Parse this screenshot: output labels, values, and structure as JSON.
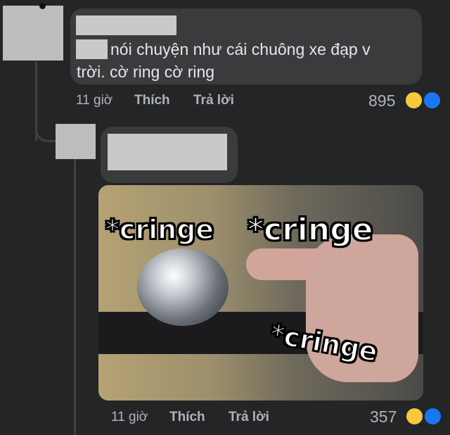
{
  "comment1": {
    "text_line1": "nói chuyện như cái chuông xe đạp v",
    "text_line2": "trời. cờ ring cờ ring",
    "time": "11 giờ",
    "like_label": "Thích",
    "reply_label": "Trả lời",
    "reaction_count": "895",
    "reactions": [
      "haha-icon",
      "like-icon"
    ]
  },
  "reply1": {
    "meme_labels": [
      "*cringe",
      "*cringe",
      "*cringe"
    ],
    "time": "11 giờ",
    "like_label": "Thích",
    "reply_label": "Trả lời",
    "reaction_count": "357",
    "reactions": [
      "haha-icon",
      "like-icon"
    ]
  },
  "colors": {
    "background": "#242526",
    "bubble": "#3a3b3c",
    "meta_text": "#b0b3b8",
    "like_blue": "#1877f2",
    "haha_yellow": "#f7c93b"
  }
}
